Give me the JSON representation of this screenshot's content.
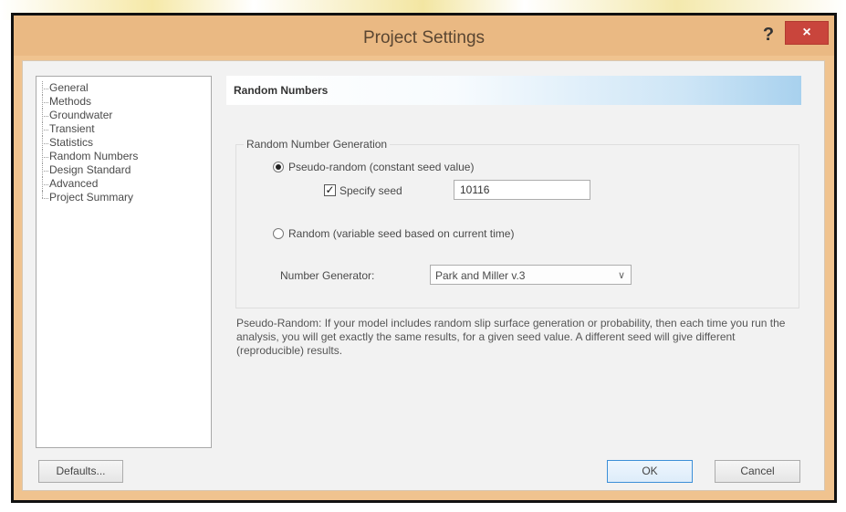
{
  "window": {
    "title": "Project Settings",
    "help_label": "?",
    "close_label": "×"
  },
  "tree": {
    "items": [
      {
        "label": "General"
      },
      {
        "label": "Methods"
      },
      {
        "label": "Groundwater"
      },
      {
        "label": "Transient"
      },
      {
        "label": "Statistics"
      },
      {
        "label": "Random Numbers",
        "selected": true
      },
      {
        "label": "Design Standard"
      },
      {
        "label": "Advanced"
      },
      {
        "label": "Project Summary"
      }
    ]
  },
  "panel": {
    "header": "Random Numbers",
    "group_title": "Random Number Generation",
    "pseudo_random_label": "Pseudo-random (constant seed value)",
    "pseudo_random_checked": true,
    "specify_seed_label": "Specify seed",
    "specify_seed_checked": true,
    "seed_value": "10116",
    "random_label": "Random (variable seed based on current time)",
    "random_checked": false,
    "generator_label": "Number Generator:",
    "generator_value": "Park and Miller v.3",
    "description": "Pseudo-Random: If your model includes random slip surface generation or probability, then each time you run the analysis, you will get exactly the same results, for a given seed value. A different seed will give different (reproducible) results."
  },
  "buttons": {
    "defaults": "Defaults...",
    "ok": "OK",
    "cancel": "Cancel"
  },
  "icons": {
    "checkmark": "✓",
    "dropdown": "chevron-down-icon",
    "close": "close-icon",
    "help": "help-icon"
  },
  "colors": {
    "titlebar": "#eab983",
    "close_button": "#c9453c",
    "header_gradient_end": "#a8d1ee",
    "ok_border": "#3c8fd8"
  }
}
